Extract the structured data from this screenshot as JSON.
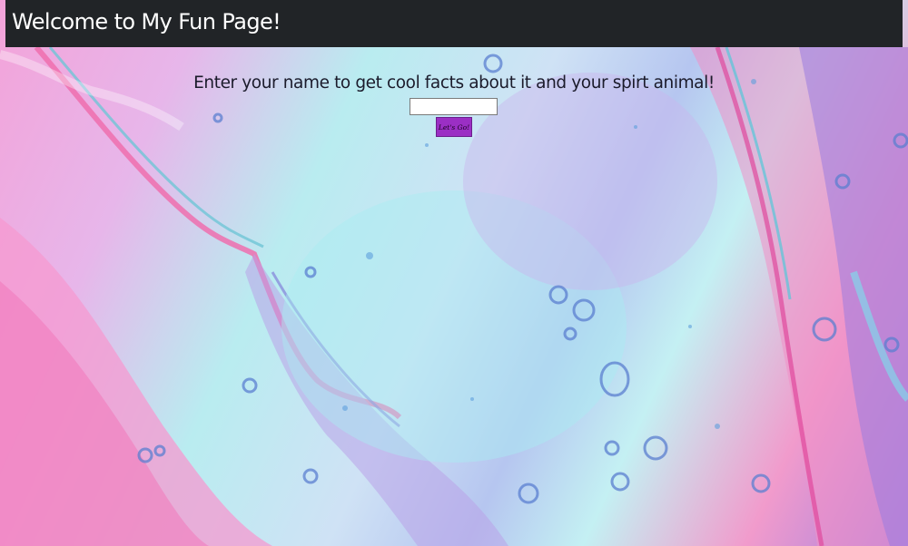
{
  "header": {
    "title": "Welcome to My Fun Page!",
    "background_color": "#212427"
  },
  "main": {
    "prompt": "Enter your name to get cool facts about it and your spirt animal!",
    "name_input": {
      "value": "",
      "placeholder": ""
    },
    "go_button": {
      "label": "Let's Go!",
      "color": "#9b2fc4"
    }
  },
  "background": {
    "description_colors": [
      "#f3a3d9",
      "#b9ecf0",
      "#a682e0",
      "#f19bcc"
    ]
  }
}
